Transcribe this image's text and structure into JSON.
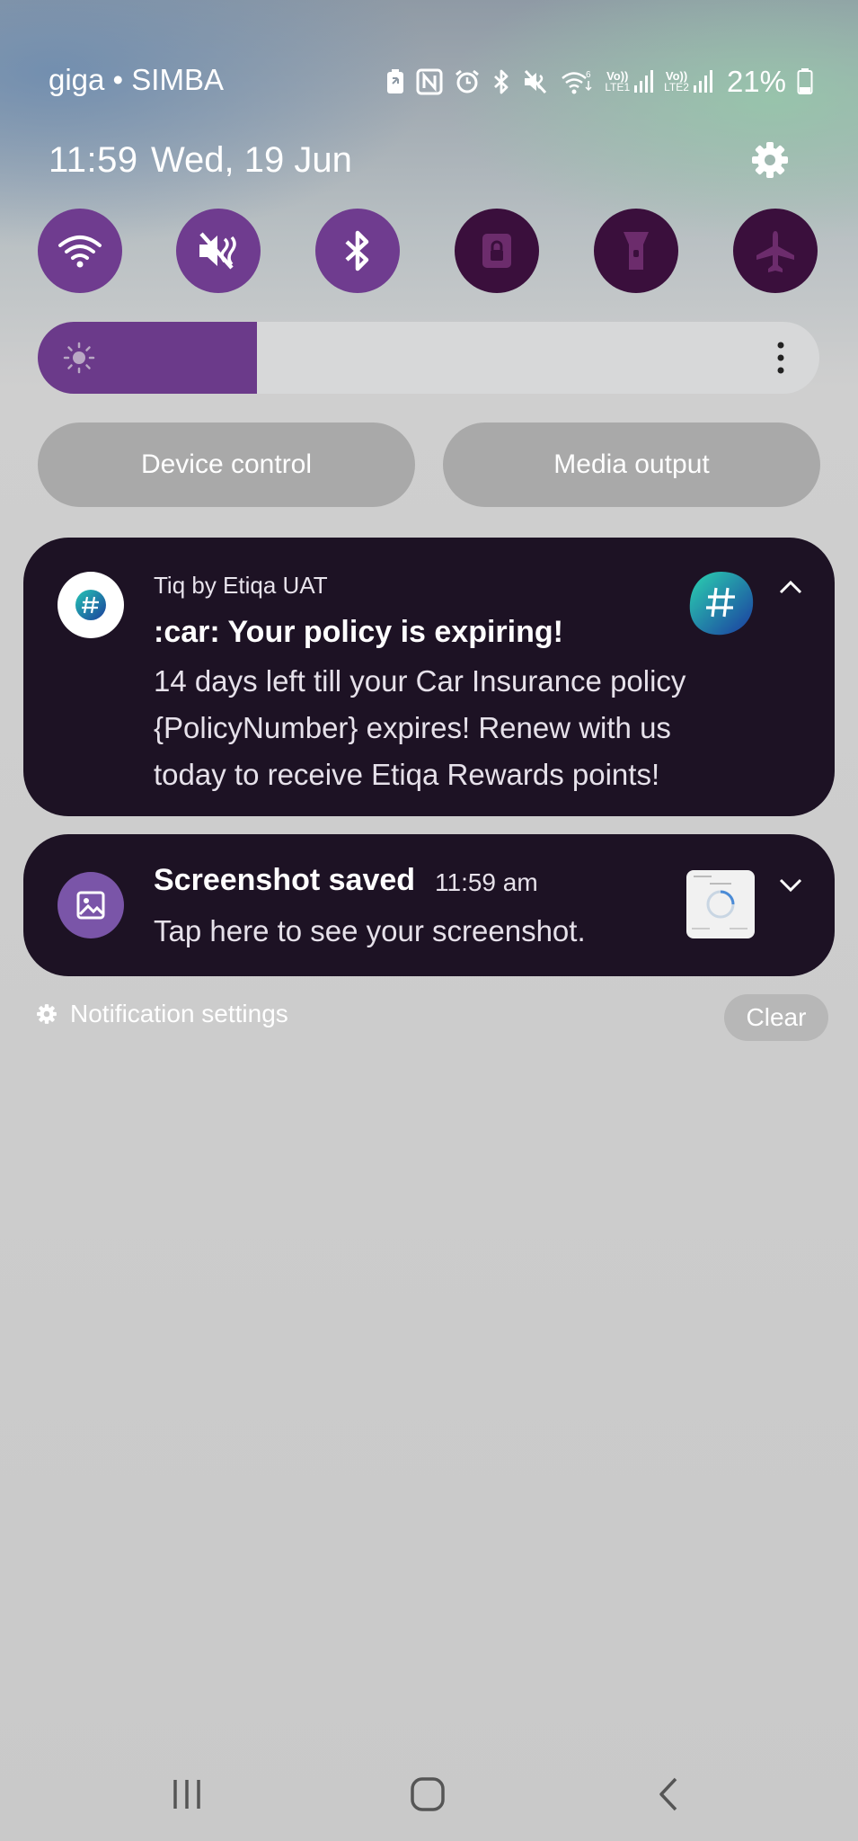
{
  "status_bar": {
    "carrier": "giga • SIMBA",
    "network_1": "LTE1",
    "network_2": "LTE2",
    "battery": "21%",
    "icons": [
      "battery-saver-icon",
      "nfc-icon",
      "alarm-icon",
      "bluetooth-icon",
      "mute-icon",
      "wifi-icon",
      "signal-icon",
      "signal-icon",
      "battery-icon"
    ]
  },
  "header": {
    "time": "11:59",
    "date": "Wed, 19 Jun"
  },
  "quick_tiles": [
    {
      "name": "wifi",
      "icon": "wifi-icon",
      "active": true
    },
    {
      "name": "mute",
      "icon": "mute-icon",
      "active": true
    },
    {
      "name": "bluetooth",
      "icon": "bluetooth-icon",
      "active": true
    },
    {
      "name": "rotation-lock",
      "icon": "lock-icon",
      "active": false
    },
    {
      "name": "flashlight",
      "icon": "flashlight-icon",
      "active": false
    },
    {
      "name": "airplane",
      "icon": "airplane-icon",
      "active": false
    }
  ],
  "brightness": {
    "level": 0.28
  },
  "buttons": {
    "device_control": "Device control",
    "media_output": "Media output"
  },
  "notifications": [
    {
      "app": "Tiq by Etiqa UAT",
      "title": ":car: Your policy is expiring!",
      "body_lines": [
        "14 days left till your Car Insurance policy",
        "{PolicyNumber} expires! Renew with us",
        "today to receive Etiqa Rewards points!"
      ]
    },
    {
      "title": "Screenshot saved",
      "time": "11:59 am",
      "body": "Tap here to see your screenshot."
    }
  ],
  "footer": {
    "notification_settings": "Notification settings",
    "clear": "Clear"
  },
  "colors": {
    "tile_active": "#6f3c8f",
    "tile_inactive": "#3a0f3c",
    "card_bg": "#1d1224",
    "brightness_fill": "#6b3a8a"
  }
}
